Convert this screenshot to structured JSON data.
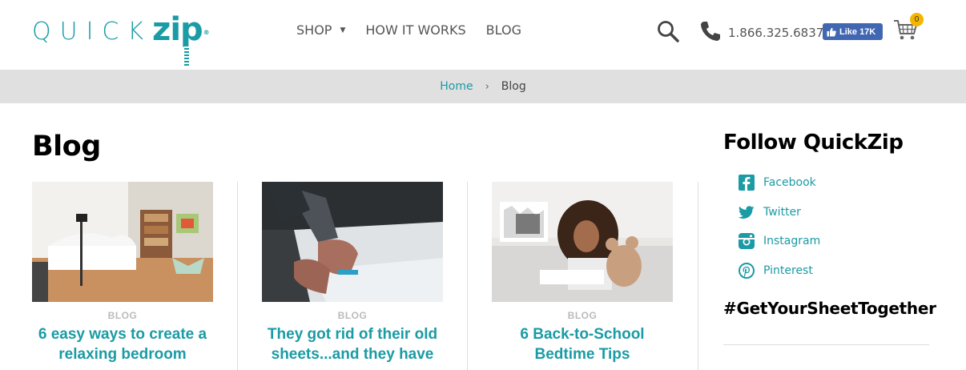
{
  "logo": {
    "quick": "QUICK",
    "zip": "zip",
    "tm": "®"
  },
  "nav": [
    {
      "label": "SHOP"
    },
    {
      "label": "HOW IT WORKS"
    },
    {
      "label": "BLOG"
    }
  ],
  "header": {
    "phone": "1.866.325.6837",
    "like_label": "Like 17K",
    "cart_count": "0"
  },
  "breadcrumb": {
    "home": "Home",
    "sep": "›",
    "current": "Blog"
  },
  "page_title": "Blog",
  "posts": [
    {
      "category": "BLOG",
      "title_line1": "6 easy ways to create a",
      "title_line2": "relaxing bedroom"
    },
    {
      "category": "BLOG",
      "title_line1": "They got rid of their old",
      "title_line2": "sheets...and they have"
    },
    {
      "category": "BLOG",
      "title_line1": "6 Back-to-School",
      "title_line2": "Bedtime Tips"
    }
  ],
  "sidebar": {
    "title": "Follow QuickZip",
    "links": [
      {
        "label": "Facebook",
        "icon": "facebook-icon"
      },
      {
        "label": "Twitter",
        "icon": "twitter-icon"
      },
      {
        "label": "Instagram",
        "icon": "instagram-icon"
      },
      {
        "label": "Pinterest",
        "icon": "pinterest-icon"
      }
    ],
    "hashtag": "#GetYourSheetTogether"
  },
  "colors": {
    "brand": "#1a9ba5",
    "breadcrumb_bg": "#e0e0e0",
    "fb_blue": "#4267b2",
    "badge": "#f5b400"
  }
}
